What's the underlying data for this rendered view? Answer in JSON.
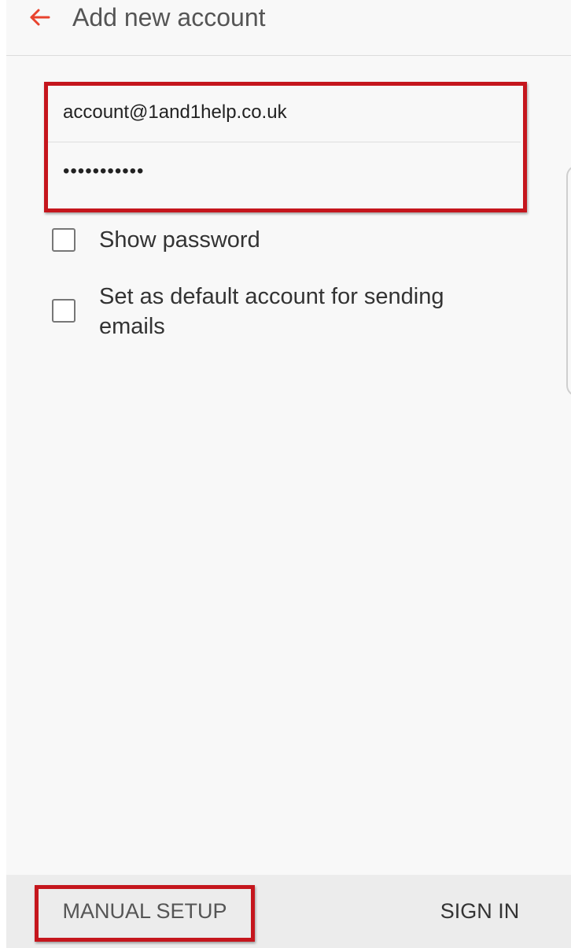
{
  "header": {
    "title": "Add new account",
    "back_icon": "arrow-left-icon",
    "accent_color": "#e8432e"
  },
  "form": {
    "email_value": "account@1and1help.co.uk",
    "password_value": "•••••••••••"
  },
  "options": {
    "show_password_label": "Show password",
    "show_password_checked": false,
    "default_account_label_line1": "Set as default account for sending",
    "default_account_label_line2": "emails",
    "default_account_checked": false
  },
  "footer": {
    "manual_setup_label": "MANUAL SETUP",
    "sign_in_label": "SIGN IN"
  },
  "highlight_color": "#c5161d"
}
